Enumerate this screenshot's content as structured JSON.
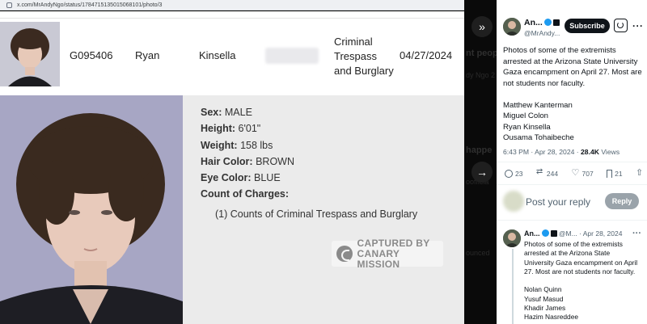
{
  "browser": {
    "url": "x.com/MrAndyNgo/status/1784715135015068101/photo/3"
  },
  "record": {
    "booking_id": "G095406",
    "first_name": "Ryan",
    "last_name": "Kinsella",
    "charge_line1": "Criminal",
    "charge_line2": "Trespass",
    "charge_line3": "and Burglary",
    "date": "04/27/2024"
  },
  "details": {
    "sex_label": "Sex:",
    "sex_value": "MALE",
    "height_label": "Height:",
    "height_value": "6'01\"",
    "weight_label": "Weight:",
    "weight_value": "158 lbs",
    "hair_label": "Hair Color:",
    "hair_value": "BROWN",
    "eye_label": "Eye Color:",
    "eye_value": "BLUE",
    "charges_label": "Count of Charges:",
    "charges_value": "(1) Counts of Criminal Trespass and Burglary"
  },
  "watermark": {
    "line1": "CAPTURED BY",
    "line2": "CANARY MISSION"
  },
  "background_text": {
    "t1": "nt peop",
    "t2": "dy Ngo 2",
    "t3": "happe",
    "t4": "oofficia",
    "t5": "ounced"
  },
  "post": {
    "author": "An...",
    "handle": "@MrAndy...",
    "subscribe_label": "Subscribe",
    "paragraph1": "Photos of some of the extremists arrested at the Arizona State University Gaza encampment on April 27. Most are not students nor faculty.",
    "names": [
      "Matthew Kanterman",
      "Miguel Colon",
      "Ryan Kinsella",
      "Ousama Tohaibeche"
    ],
    "time": "6:43 PM · Apr 28, 2024 ·",
    "views_count": "28.4K",
    "views_label": "Views",
    "replies": "23",
    "reposts": "244",
    "likes": "707",
    "bookmarks": "21"
  },
  "reply_box": {
    "placeholder": "Post your reply",
    "button_label": "Reply"
  },
  "thread_post": {
    "author": "An...",
    "handle_time": "@M... · Apr 28, 2024",
    "paragraph1": "Photos of some of the extremists arrested at the Arizona State University Gaza encampment on April 27. Most are not students nor faculty.",
    "names": [
      "Nolan Quinn",
      "Yusuf Masud",
      "Khadir James",
      "Hazim Nasreddee"
    ]
  },
  "colors": {
    "accent": "#1d9bf0",
    "reply_button": "#9aa3aa",
    "dark": "#0f1419"
  }
}
